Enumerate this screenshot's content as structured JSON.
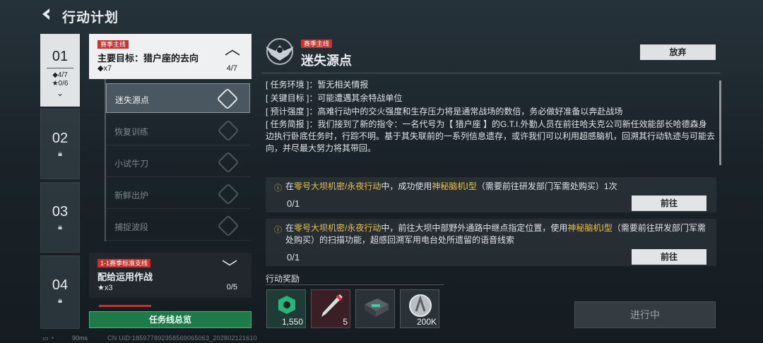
{
  "header": {
    "title": "行动计划",
    "back_icon": "back-arrow-icon"
  },
  "stages": [
    {
      "num": "01",
      "stat_a": "◆4/7",
      "stat_b": "★0/6",
      "state": "selected"
    },
    {
      "num": "02",
      "state": "locked"
    },
    {
      "num": "03",
      "state": "locked"
    },
    {
      "num": "04",
      "state": "locked"
    }
  ],
  "group1": {
    "tag": "赛季主线",
    "title": "主要目标：猎户座的去向",
    "sub": "◆x7",
    "progress": "4/7"
  },
  "tasks": [
    {
      "label": "迷失源点",
      "state": "selected"
    },
    {
      "label": "恢复训练",
      "state": "done"
    },
    {
      "label": "小试牛刀",
      "state": "done"
    },
    {
      "label": "新鲜出炉",
      "state": "done"
    },
    {
      "label": "捕捉波段",
      "state": "done"
    }
  ],
  "group2": {
    "tag": "1-1赛季标准支线",
    "title": "配给运用作战",
    "sub": "★x3",
    "progress": "0/5"
  },
  "overview_button": "任务线总览",
  "mission": {
    "tag": "赛季主线",
    "title": "迷失源点",
    "abandon": "放弃",
    "env": "[ 任务环境 ]：暂无相关情报",
    "key": "[ 关键目标 ]：可能遭遇其余特战单位",
    "intensity": "[ 预计强度 ]：高难行动中的交火强度和生存压力将是通常战场的数倍，务必做好准备以奔赴战场",
    "brief": "[ 任务简报 ]：我们接到了新的指令：一名代号为【 猎户座 】的G.T.I.外勤人员在前往哈夫克公司新任效能部长哈德森身边执行卧底任务时，行踪不明。基于其失联前的一系列信息遗存，或许我们可以利用超感脑机，回溯其行动轨迹与可能去向，并尽最大努力将其带回。"
  },
  "objectives": [
    {
      "p1": "在",
      "h1": "零号大坝机密/永夜行动",
      "p2": "中，成功使用",
      "h2": "神秘脑机Ⅰ型",
      "p3": "（需要前往研发部门军需处购买）1次",
      "progress": "0/1",
      "button": "前往"
    },
    {
      "p1": "在",
      "h1": "零号大坝机密/永夜行动",
      "p2": "中，前往大坝中部野外通路中继点指定位置，使用",
      "h2": "神秘脑机Ⅰ型",
      "p3": "（需要前往研发部门军需处购买）的扫描功能，超感回溯军用电台处所遗留的语音线索",
      "progress": "0/1",
      "button": "前往"
    }
  ],
  "rewards": {
    "label": "行动奖励",
    "items": [
      {
        "icon": "emblem-badge-icon",
        "count": "1,550"
      },
      {
        "icon": "flare-gun-icon",
        "count": "5"
      },
      {
        "icon": "ammo-box-icon",
        "count": ""
      },
      {
        "icon": "coin-icon",
        "count": "200K"
      }
    ]
  },
  "status_button": "进行中",
  "footer": {
    "ping": "90ms",
    "uid": "CN UID:18597789235856906506​3_202802121610"
  },
  "colors": {
    "accent_red": "#c8322c",
    "highlight": "#e9c04d",
    "green": "#1f7a4a"
  }
}
